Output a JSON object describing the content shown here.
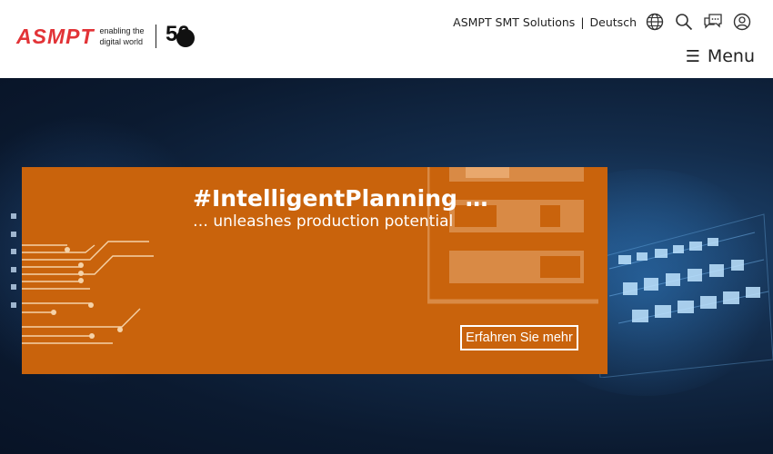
{
  "header": {
    "logo_text": "ASMPT",
    "tagline_line1": "enabling the",
    "tagline_line2": "digital world",
    "anniversary": "50",
    "nav_site": "ASMPT SMT Solutions",
    "nav_separator": "|",
    "nav_language": "Deutsch",
    "icons": [
      "globe-icon",
      "search-icon",
      "chat-icon",
      "user-icon"
    ],
    "menu_label": "Menu"
  },
  "hero": {
    "slide_dots": 6,
    "banner": {
      "title": "#IntelligentPlanning …",
      "subtitle": "… unleashes production potential",
      "cta_label": "Erfahren Sie mehr",
      "color": "#c9630c"
    }
  },
  "colors": {
    "brand_red": "#e23337",
    "banner_orange": "#c9630c",
    "hero_dark": "#0b1a30"
  }
}
